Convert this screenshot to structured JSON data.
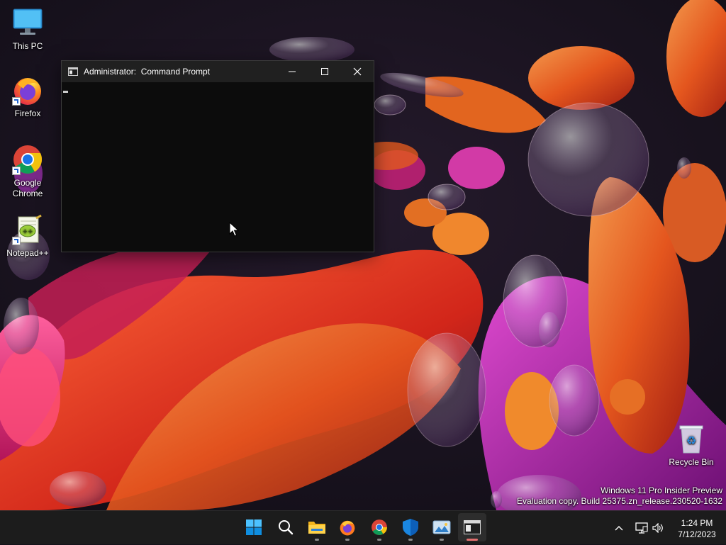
{
  "desktop": {
    "icons": [
      {
        "label": "This PC",
        "icon": "monitor-icon"
      },
      {
        "label": "Firefox",
        "icon": "firefox-icon"
      },
      {
        "label": "Google Chrome",
        "icon": "chrome-icon"
      },
      {
        "label": "Notepad++",
        "icon": "notepad-plus-plus-icon"
      },
      {
        "label": "Recycle Bin",
        "icon": "recycle-bin-icon"
      }
    ]
  },
  "window": {
    "title": "Administrator:  Command Prompt",
    "icon": "cmd-icon",
    "controls": [
      "minimize",
      "maximize",
      "close"
    ]
  },
  "watermark": {
    "line1": "Windows 11 Pro Insider Preview",
    "line2": "Evaluation copy. Build 25375.zn_release.230520-1632"
  },
  "taskbar": {
    "apps": [
      {
        "name": "Start",
        "icon": "windows-logo-icon"
      },
      {
        "name": "Search",
        "icon": "search-icon"
      },
      {
        "name": "File Explorer",
        "icon": "folder-icon"
      },
      {
        "name": "Firefox",
        "icon": "firefox-icon"
      },
      {
        "name": "Google Chrome",
        "icon": "chrome-icon"
      },
      {
        "name": "Windows Security",
        "icon": "shield-icon"
      },
      {
        "name": "Photos",
        "icon": "photos-icon"
      },
      {
        "name": "Command Prompt",
        "icon": "cmd-icon",
        "active": true
      }
    ],
    "tray": {
      "icons": [
        "chevron-up-icon",
        "network-icon",
        "volume-icon"
      ],
      "time": "1:24 PM",
      "date": "7/12/2023"
    }
  },
  "colors": {
    "taskbar_bg": "#1c1c1c",
    "console_bg": "#0c0c0c",
    "titlebar_bg": "#202020",
    "active_indicator": "#e36f6f"
  }
}
